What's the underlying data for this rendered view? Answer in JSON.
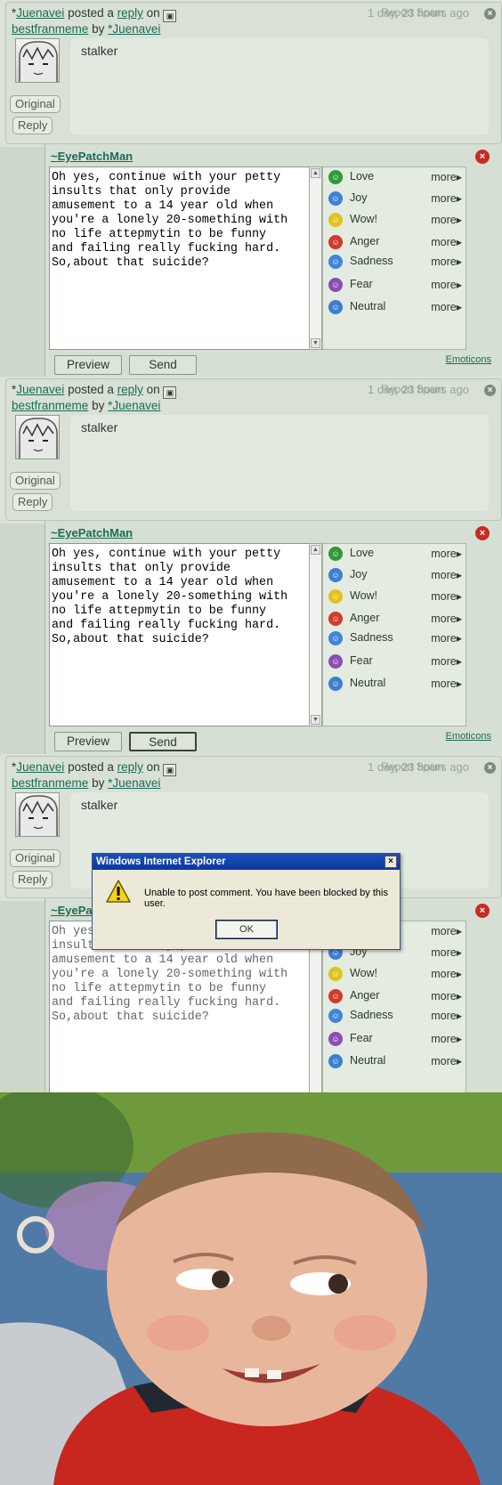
{
  "comment": {
    "prefix": "*",
    "author": "Juenavei",
    "posted_a": "posted a",
    "reply_word": "reply",
    "on_word": "on",
    "deviation": "bestfranmeme",
    "by_word": "by",
    "deviation_author": "*Juenavei",
    "report_spam": "Report Spam",
    "time_ago": "1 day, 23 hours ago",
    "close_glyph": "×",
    "body": "stalker",
    "original_btn": "Original",
    "reply_btn": "Reply"
  },
  "reply_form": {
    "username": "~EyePatchMan",
    "close_glyph": "×",
    "text": "Oh yes, continue with your petty\ninsults that only provide\namusement to a 14 year old when\nyou're a lonely 20-something with\nno life attepmytin to be funny\nand failing really fucking hard.\nSo,about that suicide?",
    "preview_btn": "Preview",
    "send_btn": "Send",
    "emoticons_link": "Emoticons"
  },
  "emoticons": {
    "more_label": "more",
    "arrow_glyph": "▸",
    "items": [
      {
        "label": "Love",
        "icon": "love-icon",
        "color": "#2f9a3a"
      },
      {
        "label": "Joy",
        "icon": "joy-icon",
        "color": "#3f7fd6"
      },
      {
        "label": "Wow!",
        "icon": "wow-icon",
        "color": "#e0c21e"
      },
      {
        "label": "Anger",
        "icon": "anger-icon",
        "color": "#d23a2a"
      },
      {
        "label": "Sadness",
        "icon": "sadness-icon",
        "color": "#3f86d9"
      },
      {
        "label": "Fear",
        "icon": "fear-icon",
        "color": "#8a4fb5"
      },
      {
        "label": "Neutral",
        "icon": "neutral-icon",
        "color": "#3c7fd0"
      }
    ]
  },
  "dialog": {
    "title": "Windows Internet Explorer",
    "message": "Unable to post comment. You have been blocked by this user.",
    "ok": "OK",
    "close_glyph": "×"
  },
  "colors": {
    "panel_bg": "#dbe3d8",
    "link": "#1c6c56",
    "close_red": "#c52c22",
    "xp_title": "#0c379f"
  }
}
